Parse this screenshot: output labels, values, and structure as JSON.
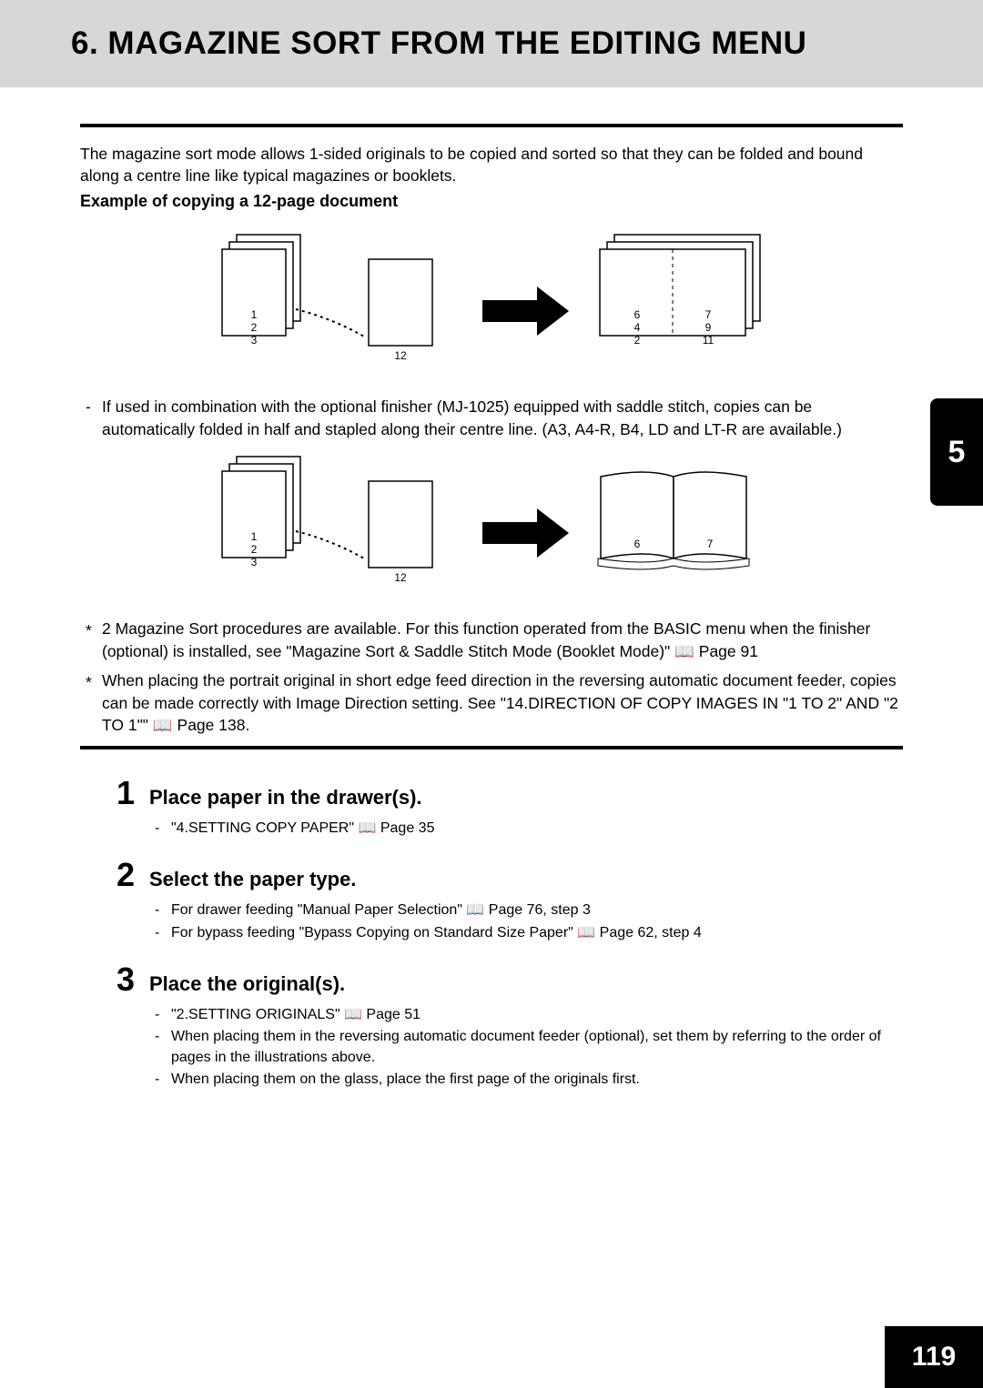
{
  "header": {
    "title": "6. MAGAZINE SORT FROM THE EDITING MENU"
  },
  "intro": "The magazine sort mode allows 1-sided originals to be copied and sorted so that they can be folded and bound along a centre line like typical magazines or booklets.",
  "example_label": "Example of copying a 12-page document",
  "diagram1": {
    "stack_labels": [
      "1",
      "2",
      "3"
    ],
    "single_label": "12",
    "book_labels": {
      "tl": "6",
      "tr": "7",
      "ml": "4",
      "mr": "9",
      "bl": "2",
      "br": "11"
    }
  },
  "bullet1": "If used in combination with the optional finisher (MJ-1025) equipped with saddle stitch, copies can be automatically folded in half and stapled along their centre line. (A3, A4-R, B4, LD and LT-R are available.)",
  "diagram2": {
    "stack_labels": [
      "1",
      "2",
      "3"
    ],
    "single_label": "12",
    "open_labels": {
      "l": "6",
      "r": "7"
    }
  },
  "star1": "2 Magazine Sort procedures are available. For this function operated from the BASIC menu when the finisher (optional) is installed, see \"Magazine Sort & Saddle Stitch Mode (Booklet Mode)\" 📖 Page 91",
  "star2": "When placing the portrait original in short edge feed direction in the reversing automatic document feeder, copies can be made correctly with Image Direction setting. See \"14.DIRECTION OF COPY IMAGES IN \"1 TO 2\" AND \"2 TO 1\"\" 📖 Page 138.",
  "steps": [
    {
      "num": "1",
      "title": "Place paper in the drawer(s).",
      "items": [
        "\"4.SETTING COPY PAPER\" 📖 Page 35"
      ]
    },
    {
      "num": "2",
      "title": "Select the paper type.",
      "items": [
        "For drawer feeding \"Manual Paper Selection\" 📖 Page 76, step 3",
        "For bypass feeding \"Bypass Copying on Standard Size Paper\" 📖 Page 62, step 4"
      ]
    },
    {
      "num": "3",
      "title": "Place the original(s).",
      "items": [
        "\"2.SETTING ORIGINALS\" 📖 Page 51",
        "When placing them in the reversing automatic document feeder (optional), set them by referring to the order of pages in the illustrations above.",
        "When placing them on the glass, place the first page of the originals first."
      ]
    }
  ],
  "side_tab": "5",
  "page_number": "119"
}
